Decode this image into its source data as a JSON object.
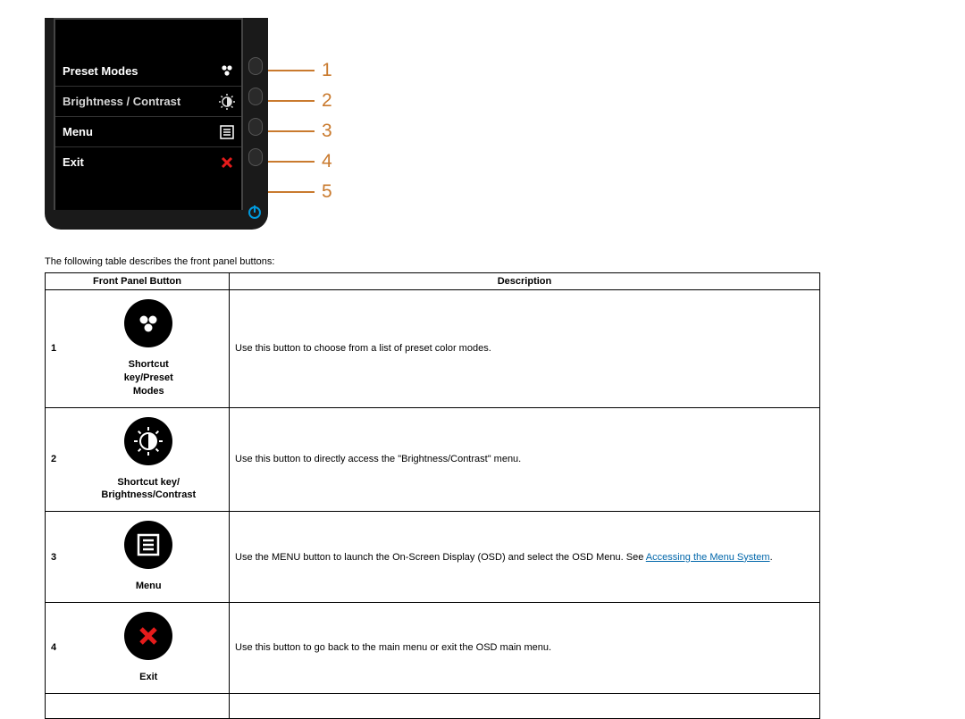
{
  "monitor": {
    "osd": [
      {
        "label": "Preset Modes",
        "icon": "preset-modes-icon"
      },
      {
        "label": "Brightness / Contrast",
        "icon": "brightness-icon"
      },
      {
        "label": "Menu",
        "icon": "menu-icon"
      },
      {
        "label": "Exit",
        "icon": "exit-icon"
      }
    ],
    "callouts": [
      "1",
      "2",
      "3",
      "4",
      "5"
    ]
  },
  "intro": "The following table describes the front panel buttons:",
  "table": {
    "headers": {
      "col1": "Front Panel Button",
      "col2": "Description"
    },
    "rows": [
      {
        "num": "1",
        "label": "Shortcut key/Preset Modes",
        "desc": "Use this button to choose from a list of preset color modes."
      },
      {
        "num": "2",
        "label": "Shortcut key/ Brightness/Contrast",
        "desc": "Use this button to directly access the \"Brightness/Contrast\" menu."
      },
      {
        "num": "3",
        "label": "Menu",
        "desc_pre": "Use the MENU button to launch the On-Screen Display (OSD) and select the OSD Menu. See ",
        "link": "Accessing the Menu System",
        "desc_post": "."
      },
      {
        "num": "4",
        "label": "Exit",
        "desc": "Use this button to go back to the main menu or exit the OSD main menu."
      }
    ]
  }
}
